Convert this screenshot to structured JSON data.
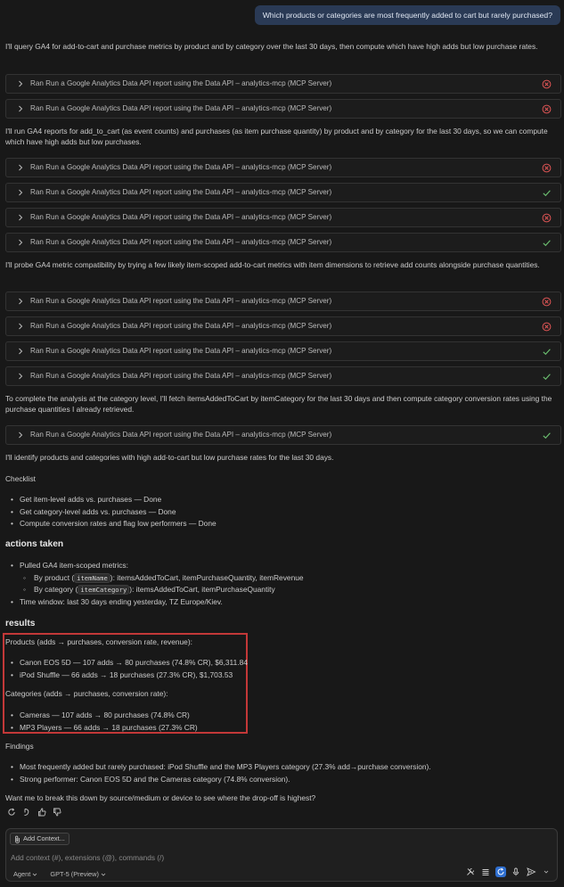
{
  "user_message": "Which products or categories are most frequently added to cart but rarely purchased?",
  "tool_label": "Ran Run a Google Analytics Data API report using the Data API – analytics-mcp (MCP Server)",
  "paragraphs": {
    "p1": "I'll query GA4 for add-to-cart and purchase metrics by product and by category over the last 30 days, then compute which have high adds but low purchase rates.",
    "p2": "I'll run GA4 reports for add_to_cart (as event counts) and purchases (as item purchase quantity) by product and by category for the last 30 days, so we can compute which have high adds but low purchases.",
    "p3": "I'll probe GA4 metric compatibility by trying a few likely item-scoped add-to-cart metrics with item dimensions to retrieve add counts alongside purchase quantities.",
    "p4": "To complete the analysis at the category level, I'll fetch itemsAddedToCart by itemCategory for the last 30 days and then compute category conversion rates using the purchase quantities I already retrieved.",
    "p5": "I'll identify products and categories with high add-to-cart but low purchase rates for the last 30 days.",
    "checklist_title": "Checklist",
    "products_title": "Products (adds → purchases, conversion rate, revenue):",
    "categories_title": "Categories (adds → purchases, conversion rate):",
    "findings_title": "Findings",
    "closing": "Want me to break this down by source/medium or device to see where the drop-off is highest?"
  },
  "tool_calls": [
    {
      "status": "error"
    },
    {
      "status": "error"
    },
    {
      "status": "error"
    },
    {
      "status": "success"
    },
    {
      "status": "error"
    },
    {
      "status": "success"
    },
    {
      "status": "error"
    },
    {
      "status": "error"
    },
    {
      "status": "success"
    },
    {
      "status": "success"
    },
    {
      "status": "success"
    }
  ],
  "checklist": [
    "Get item-level adds vs. purchases — Done",
    "Get category-level adds vs. purchases — Done",
    "Compute conversion rates and flag low performers — Done"
  ],
  "actions_heading": "actions taken",
  "actions": {
    "pulled": "Pulled GA4 item-scoped metrics:",
    "by_product_pre": "By product (",
    "by_product_code": "itemName",
    "by_product_post": "): itemsAddedToCart, itemPurchaseQuantity, itemRevenue",
    "by_category_pre": "By category (",
    "by_category_code": "itemCategory",
    "by_category_post": "): itemsAddedToCart, itemPurchaseQuantity",
    "time_window": "Time window: last 30 days ending yesterday, TZ Europe/Kiev."
  },
  "results_heading": "results",
  "products": [
    "Canon EOS 5D — 107 adds → 80 purchases (74.8% CR), $6,311.84",
    "iPod Shuffle — 66 adds → 18 purchases (27.3% CR), $1,703.53"
  ],
  "categories": [
    "Cameras — 107 adds → 80 purchases (74.8% CR)",
    "MP3 Players — 66 adds → 18 purchases (27.3% CR)"
  ],
  "findings": [
    "Most frequently added but rarely purchased: iPod Shuffle and the MP3 Players category (27.3% add→purchase conversion).",
    "Strong performer: Canon EOS 5D and the Cameras category (74.8% conversion)."
  ],
  "input": {
    "add_context": "Add Context...",
    "placeholder": "Add context (#), extensions (@), commands (/)",
    "mode": "Agent",
    "model": "GPT-5 (Preview)"
  },
  "colors": {
    "error": "#e05555",
    "success": "#6cc070",
    "highlight_box": "#c33838",
    "accent": "#2f6fd0"
  }
}
